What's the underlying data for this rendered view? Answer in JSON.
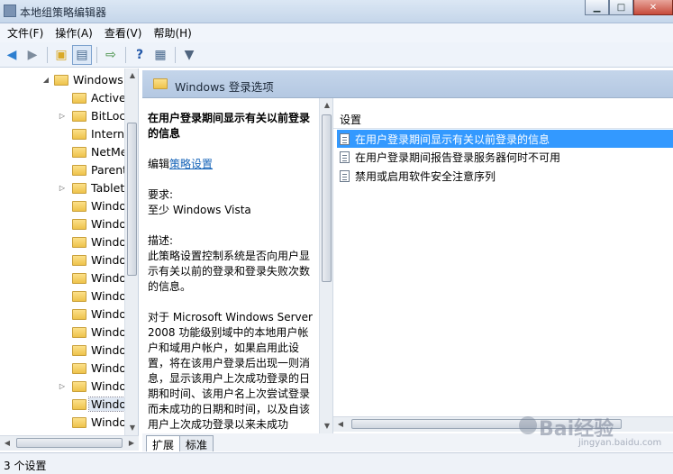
{
  "window": {
    "title": "本地组策略编辑器"
  },
  "menu": [
    "文件(F)",
    "操作(A)",
    "查看(V)",
    "帮助(H)"
  ],
  "toolbar": {
    "icons": [
      "back-arrow-icon",
      "forward-arrow-icon",
      "up-folder-icon",
      "show-hide-tree-icon",
      "export-list-icon",
      "help-icon",
      "properties-icon",
      "filter-icon"
    ]
  },
  "tree": {
    "items": [
      {
        "label": "Windows",
        "expanded": true
      },
      {
        "label": "Active"
      },
      {
        "label": "BitLoc",
        "has_children": true
      },
      {
        "label": "Intern"
      },
      {
        "label": "NetMe"
      },
      {
        "label": "Parent"
      },
      {
        "label": "Tablet",
        "has_children": true
      },
      {
        "label": "Windo"
      },
      {
        "label": "Windo"
      },
      {
        "label": "Windo"
      },
      {
        "label": "Windo"
      },
      {
        "label": "Windo"
      },
      {
        "label": "Windo"
      },
      {
        "label": "Windo"
      },
      {
        "label": "Windo"
      },
      {
        "label": "Windo"
      },
      {
        "label": "Windo"
      },
      {
        "label": "Windo",
        "has_children": true
      },
      {
        "label": "Windo",
        "selected": true
      },
      {
        "label": "Windo"
      }
    ]
  },
  "panel": {
    "header_title": "Windows 登录选项",
    "description": {
      "title": "在用户登录期间显示有关以前登录的信息",
      "edit_prefix": "编辑",
      "edit_link": "策略设置",
      "req_label": "要求:",
      "req_value": "至少 Windows Vista",
      "desc_label": "描述:",
      "desc_text": "此策略设置控制系统是否向用户显示有关以前的登录和登录失败次数的信息。",
      "desc_more": "对于 Microsoft Windows Server 2008 功能级别域中的本地用户帐户和域用户帐户，如果启用此设置，将在该用户登录后出现一则消息，显示该用户上次成功登录的日期和时间、该用户名上次尝试登录而未成功的日期和时间，以及自该用户上次成功登录以来未成功"
    },
    "list_header": "设置",
    "settings": [
      {
        "label": "在用户登录期间显示有关以前登录的信息",
        "selected": true
      },
      {
        "label": "在用户登录期间报告登录服务器何时不可用"
      },
      {
        "label": "禁用或启用软件安全注意序列"
      }
    ]
  },
  "tabs": [
    "扩展",
    "标准"
  ],
  "status": "3 个设置",
  "watermark": {
    "brand": "Bai",
    "brand2": "经验",
    "sub": "jingyan.baidu.com"
  }
}
